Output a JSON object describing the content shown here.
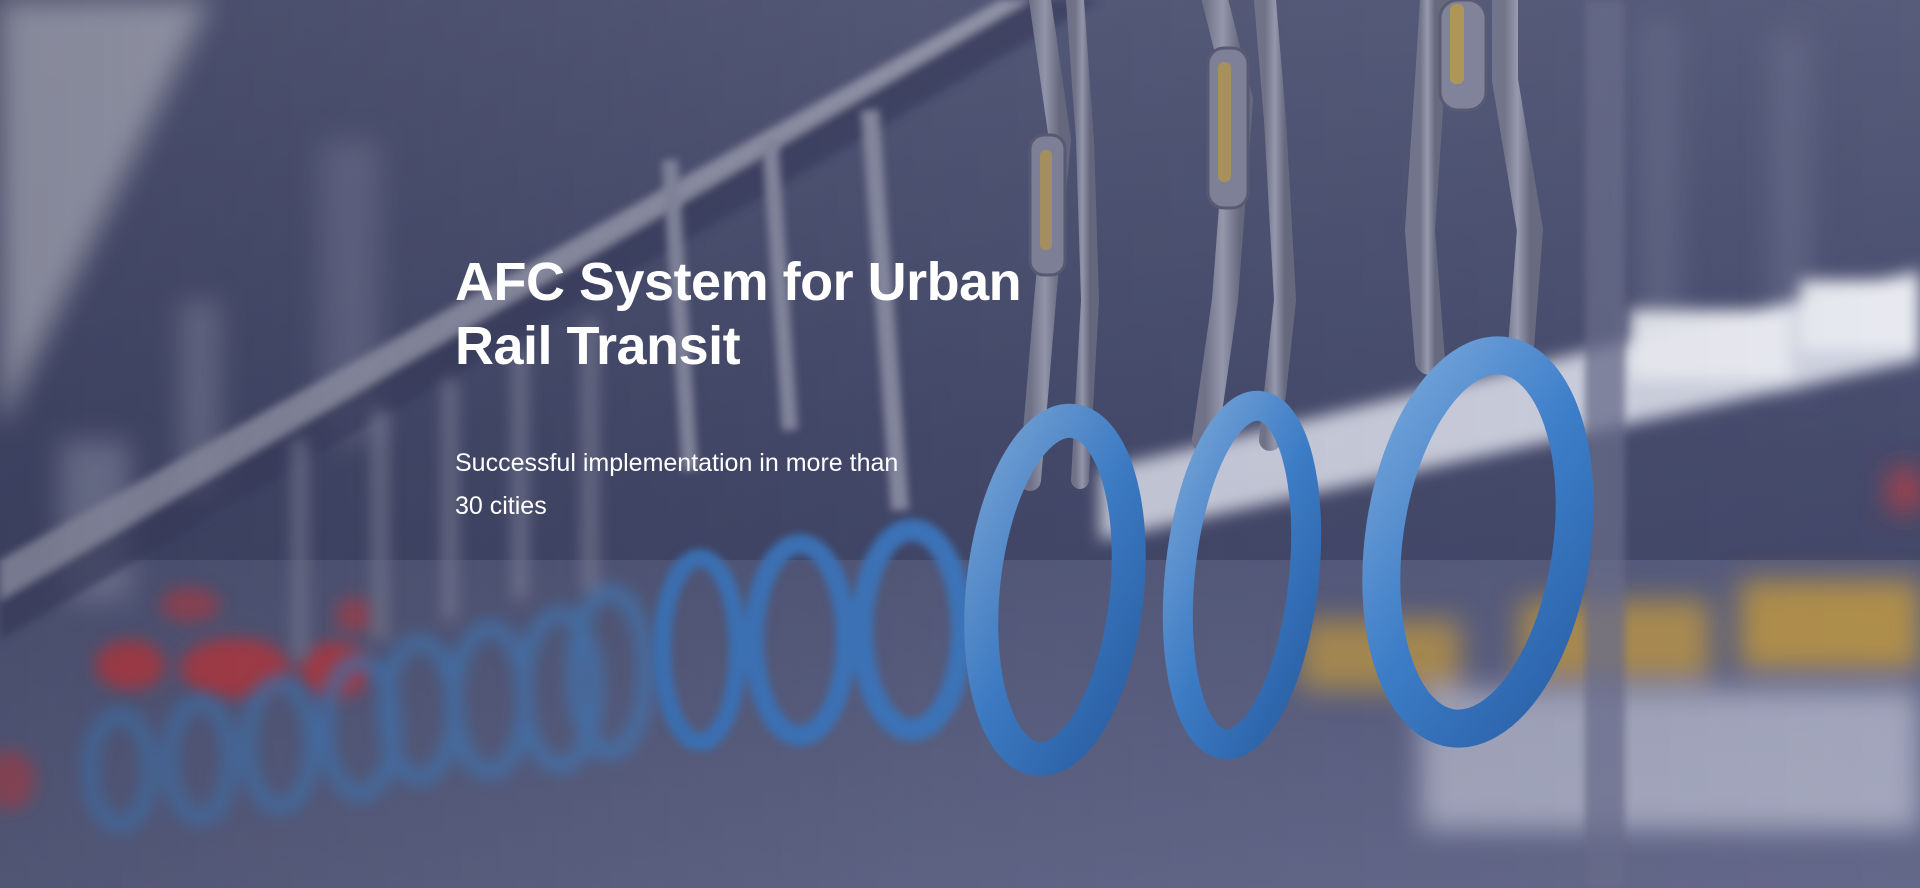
{
  "hero": {
    "title": "AFC System for Urban Rail Transit",
    "subtitle": "Successful implementation in more than 30 cities",
    "background_image": "subway-hand-straps-photo",
    "accent_color": "#3f86d6",
    "text_color": "#ffffff"
  }
}
